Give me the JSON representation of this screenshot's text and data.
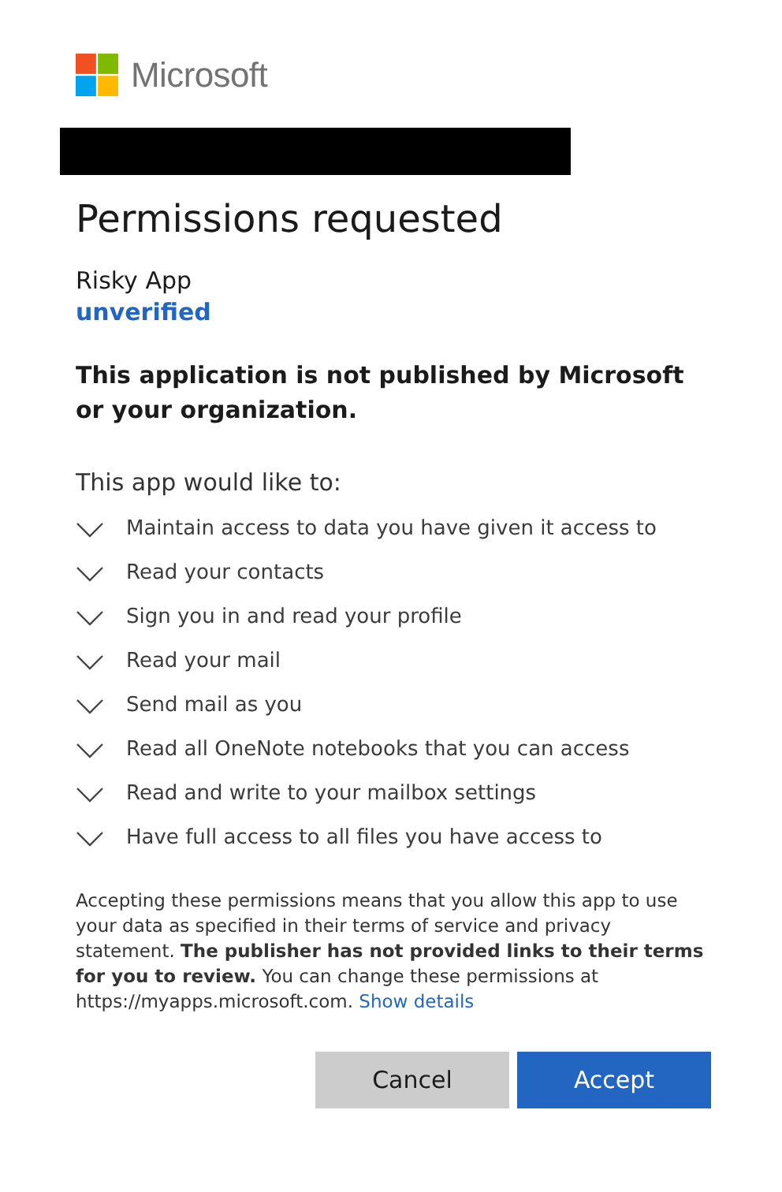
{
  "brand": {
    "name": "Microsoft"
  },
  "title": "Permissions requested",
  "app": {
    "name": "Risky App",
    "status": "unverified"
  },
  "warning": "This application is not published by Microsoft or your organization.",
  "intro": "This app would like to:",
  "permissions": [
    {
      "label": "Maintain access to data you have given it access to",
      "expanded": false
    },
    {
      "label": "Read your contacts",
      "expanded": false
    },
    {
      "label": "Sign you in and read your profile",
      "expanded": false
    },
    {
      "label": "Read your mail",
      "expanded": false
    },
    {
      "label": "Send mail as you",
      "expanded": false
    },
    {
      "label": "Read all OneNote notebooks that you can access",
      "expanded": false
    },
    {
      "label": "Read and write to your mailbox settings",
      "expanded": false
    },
    {
      "label": "Have full access to all files you have access to",
      "expanded": false
    }
  ],
  "notice": {
    "text": "Accepting these permissions means that you allow this app to use your data as specified in their terms of service and privacy statement. **The publisher has not provided links to their terms for you to review.** You can change these permissions at https://myapps.microsoft.com.",
    "link": "Show details"
  },
  "buttons": [
    {
      "label": "Cancel",
      "kind": "secondary"
    },
    {
      "label": "Accept",
      "kind": "primary"
    }
  ]
}
